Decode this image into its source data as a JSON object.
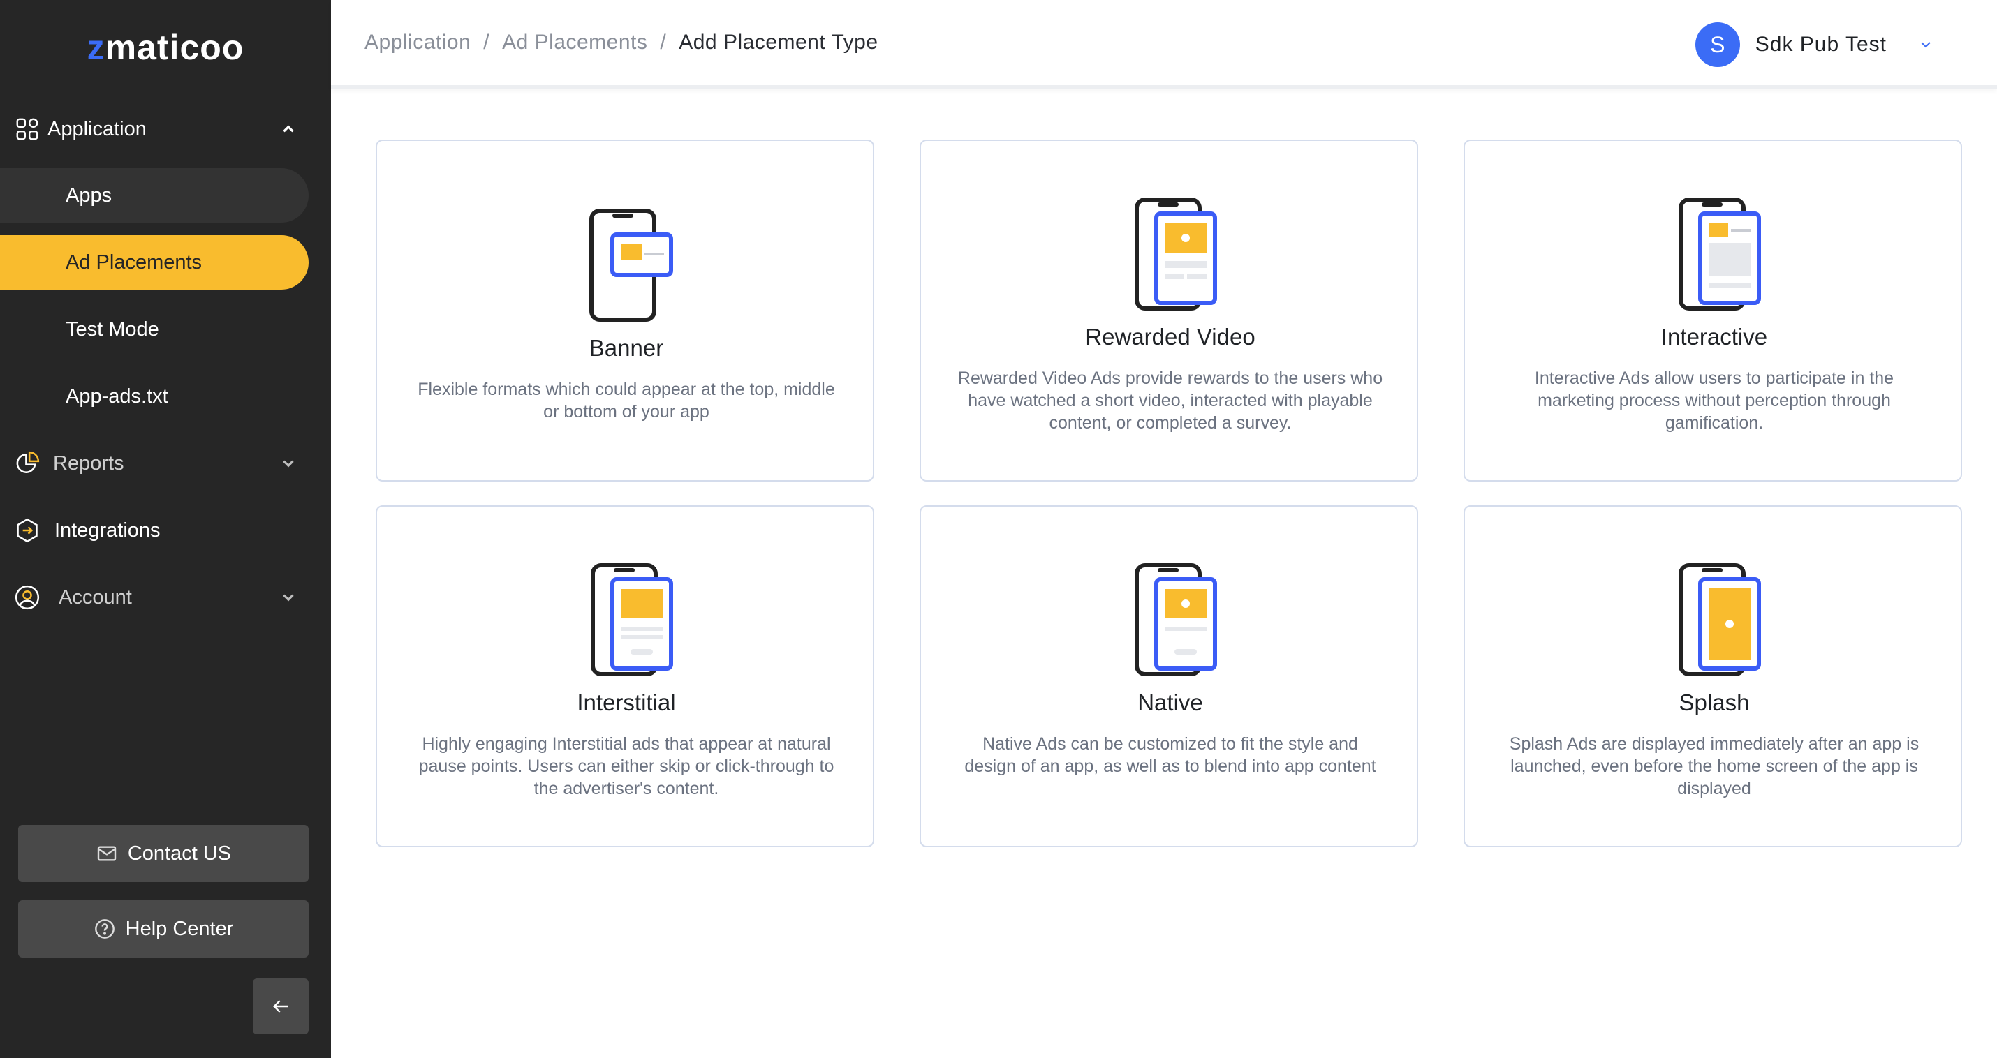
{
  "brand": {
    "logo_mark": "z",
    "logo_text": "maticoo"
  },
  "sidebar": {
    "application_label": "Application",
    "sub_items": [
      "Apps",
      "Ad Placements",
      "Test Mode",
      "App-ads.txt"
    ],
    "reports_label": "Reports",
    "integrations_label": "Integrations",
    "account_label": "Account",
    "contact_label": "Contact US",
    "help_label": "Help Center"
  },
  "header": {
    "breadcrumb": [
      "Application",
      "Ad Placements",
      "Add Placement Type"
    ],
    "separator": "/",
    "user_initial": "S",
    "user_name": "Sdk Pub Test"
  },
  "cards": [
    {
      "title": "Banner",
      "desc": "Flexible formats which could appear at the top, middle or bottom of your app"
    },
    {
      "title": "Rewarded Video",
      "desc": "Rewarded Video Ads provide rewards to the users who have watched a short video, interacted with playable content, or completed a survey."
    },
    {
      "title": "Interactive",
      "desc": "Interactive Ads allow users to participate in the marketing process without perception through gamification."
    },
    {
      "title": "Interstitial",
      "desc": "Highly engaging Interstitial ads that appear at natural pause points. Users can either skip or click-through to the advertiser's content."
    },
    {
      "title": "Native",
      "desc": "Native Ads can be customized to fit the style and design of an app, as well as to blend into app content"
    },
    {
      "title": "Splash",
      "desc": "Splash Ads are displayed immediately after an app is launched, even before the home screen of the app is displayed"
    }
  ],
  "colors": {
    "accent": "#f9bc2e",
    "brand_blue": "#3b6cf6",
    "sidebar_bg": "#262626"
  },
  "icons": [
    "application-icon",
    "chevron-up-icon",
    "reports-icon",
    "chevron-down-icon",
    "integrations-icon",
    "account-icon",
    "mail-icon",
    "help-icon",
    "arrow-left-icon"
  ]
}
